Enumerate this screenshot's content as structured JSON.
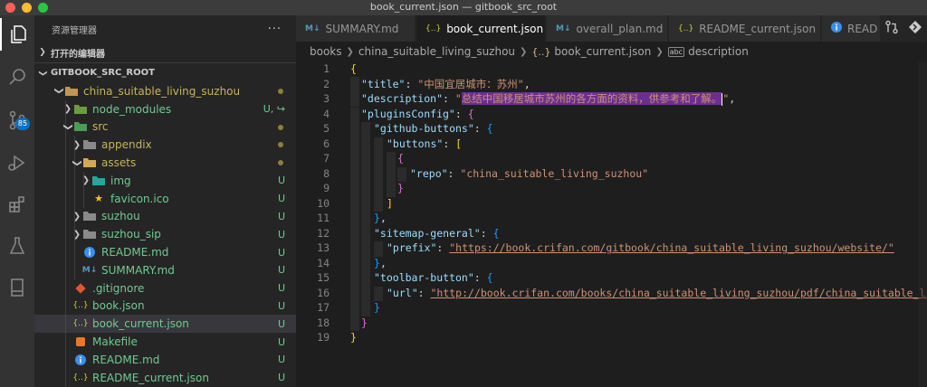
{
  "window": {
    "title": "book_current.json — gitbook_src_root"
  },
  "activity_bar": {
    "scm_badge": "85"
  },
  "sidebar": {
    "title": "资源管理器",
    "more": "···",
    "open_editors": "打开的编辑器",
    "root": "GITBOOK_SRC_ROOT",
    "tree": [
      {
        "label": "china_suitable_living_suzhou",
        "status": ""
      },
      {
        "label": "node_modules",
        "status": "U, ↪"
      },
      {
        "label": "src",
        "status": ""
      },
      {
        "label": "appendix",
        "status": ""
      },
      {
        "label": "assets",
        "status": ""
      },
      {
        "label": "img",
        "status": "U"
      },
      {
        "label": "favicon.ico",
        "status": "U"
      },
      {
        "label": "suzhou",
        "status": "U"
      },
      {
        "label": "suzhou_sip",
        "status": "U"
      },
      {
        "label": "README.md",
        "status": "U"
      },
      {
        "label": "SUMMARY.md",
        "status": "U"
      },
      {
        "label": ".gitignore",
        "status": "U"
      },
      {
        "label": "book.json",
        "status": "U"
      },
      {
        "label": "book_current.json",
        "status": "U"
      },
      {
        "label": "Makefile",
        "status": "U"
      },
      {
        "label": "README.md",
        "status": "U"
      },
      {
        "label": "README_current.json",
        "status": "U"
      }
    ]
  },
  "tabs": [
    {
      "label": "SUMMARY.md",
      "icon": "M↓"
    },
    {
      "label": "book_current.json",
      "icon": "{..}"
    },
    {
      "label": "overall_plan.md",
      "icon": "M↓"
    },
    {
      "label": "README_current.json",
      "icon": "{..}"
    },
    {
      "label": "READ",
      "icon": "i"
    }
  ],
  "breadcrumb": {
    "items": [
      "books",
      "china_suitable_living_suzhou",
      "book_current.json",
      "description"
    ]
  },
  "editor": {
    "line_numbers": [
      "1",
      "2",
      "3",
      "4",
      "5",
      "6",
      "7",
      "8",
      "9",
      "10",
      "11",
      "12",
      "13",
      "14",
      "15",
      "16",
      "17",
      "18",
      "19"
    ],
    "title_key": "\"title\"",
    "title_val": "\"中国宜居城市：苏州\"",
    "desc_key": "\"description\"",
    "desc_val": "总结中国移居城市苏州的各方面的资料，供参考和了解。",
    "plugins_key": "\"pluginsConfig\"",
    "github_key": "\"github-buttons\"",
    "buttons_key": "\"buttons\"",
    "repo_key": "\"repo\"",
    "repo_val": "\"china_suitable_living_suzhou\"",
    "sitemap_key": "\"sitemap-general\"",
    "prefix_key": "\"prefix\"",
    "prefix_val": "\"https://book.crifan.com/gitbook/china_suitable_living_suzhou/website/\"",
    "toolbar_key": "\"toolbar-button\"",
    "url_key": "\"url\"",
    "url_val": "\"http://book.crifan.com/books/china_suitable_living_suzhou/pdf/china_suitable_living_suzhou.pdf\""
  }
}
